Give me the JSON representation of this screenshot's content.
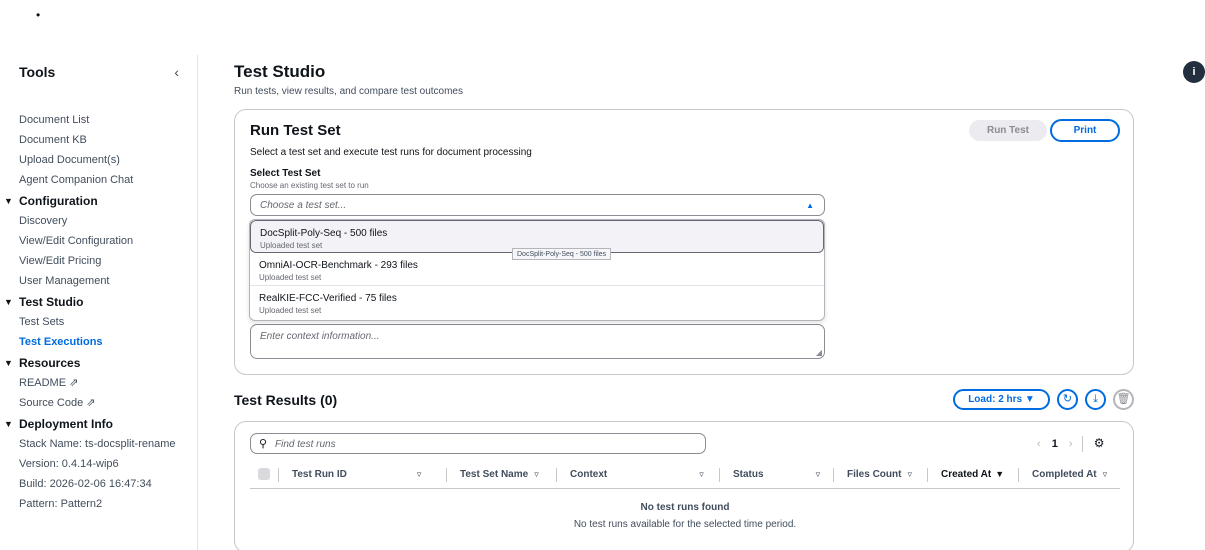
{
  "top_bullet": "•",
  "sidebar": {
    "title": "Tools",
    "collapse_icon": "‹",
    "items_top": [
      "Document List",
      "Document KB",
      "Upload Document(s)",
      "Agent Companion Chat"
    ],
    "configuration": {
      "label": "Configuration",
      "items": [
        "Discovery",
        "View/Edit Configuration",
        "View/Edit Pricing",
        "User Management"
      ]
    },
    "test_studio": {
      "label": "Test Studio",
      "items": [
        "Test Sets",
        "Test Executions"
      ],
      "active": "Test Executions"
    },
    "resources": {
      "label": "Resources",
      "items": [
        "README",
        "Source Code"
      ]
    },
    "deployment": {
      "label": "Deployment Info",
      "items": [
        "Stack Name: ts-docsplit-rename",
        "Version: 0.4.14-wip6",
        "Build: 2026-02-06 16:47:34",
        "Pattern: Pattern2"
      ]
    }
  },
  "page": {
    "title": "Test Studio",
    "subtitle": "Run tests, view results, and compare test outcomes"
  },
  "run_card": {
    "title": "Run Test Set",
    "subtitle": "Select a test set and execute test runs for document processing",
    "run_button": "Run Test",
    "print_button": "Print",
    "select_label": "Select Test Set",
    "select_desc": "Choose an existing test set to run",
    "select_placeholder": "Choose a test set...",
    "context_placeholder": "Enter context information...",
    "options": [
      {
        "title": "DocSplit-Poly-Seq - 500 files",
        "desc": "Uploaded test set"
      },
      {
        "title": "OmniAI-OCR-Benchmark - 293 files",
        "desc": "Uploaded test set"
      },
      {
        "title": "RealKIE-FCC-Verified - 75 files",
        "desc": "Uploaded test set"
      }
    ],
    "tooltip": "DocSplit-Poly-Seq - 500 files"
  },
  "results": {
    "title": "Test Results (0)",
    "load_button": "Load: 2 hrs ▼",
    "search_placeholder": "Find test runs",
    "page_number": "1",
    "columns": [
      "Test Run ID",
      "Test Set Name",
      "Context",
      "Status",
      "Files Count",
      "Created At",
      "Completed At"
    ],
    "empty_title": "No test runs found",
    "empty_desc": "No test runs available for the selected time period."
  },
  "icons": {
    "info": "info-icon",
    "refresh": "refresh-icon",
    "download": "download-icon",
    "delete": "trash-icon",
    "search": "search-icon",
    "settings": "gear-icon",
    "external": "external-link-icon"
  },
  "colors": {
    "accent": "#006ce0",
    "text": "#0f141a",
    "muted": "#414d5c",
    "border": "#c6c6cd"
  }
}
